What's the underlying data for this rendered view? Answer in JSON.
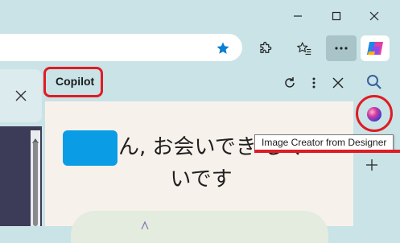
{
  "window_controls": {
    "minimize": "minimize",
    "maximize": "maximize",
    "close": "close"
  },
  "copilot_pane": {
    "title": "Copilot",
    "greeting_line1": "さん, お会いでき   しく",
    "greeting_line2": "いです"
  },
  "tooltip": {
    "text": "Image Creator from Designer"
  },
  "colors": {
    "highlight": "#e01b24",
    "accent": "#0a7fd4",
    "pane_bg": "#f7f1ec",
    "chrome_bg": "#c9e3e6"
  }
}
